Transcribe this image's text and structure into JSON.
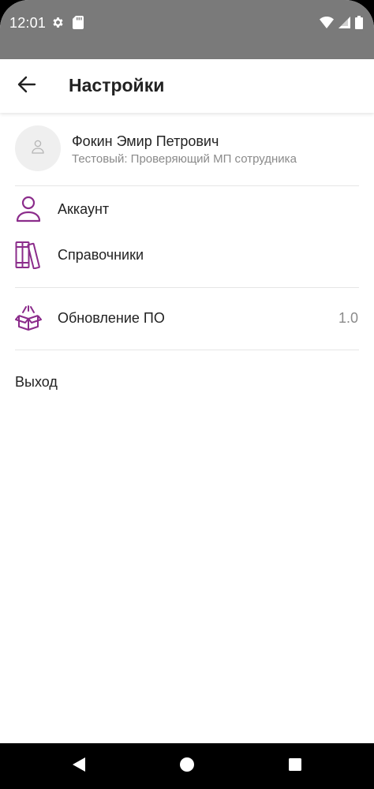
{
  "status_bar": {
    "time": "12:01",
    "icons_left": [
      "gear-icon",
      "sd-card-icon"
    ],
    "icons_right": [
      "wifi-icon",
      "cell-signal-icon",
      "battery-icon"
    ]
  },
  "app_bar": {
    "back_icon": "arrow-left-icon",
    "title": "Настройки"
  },
  "profile": {
    "avatar_icon": "person-icon",
    "name": "Фокин Эмир Петрович",
    "role": "Тестовый: Проверяющий МП сотрудника"
  },
  "menu": {
    "account": {
      "icon": "person-outline-icon",
      "label": "Аккаунт"
    },
    "directories": {
      "icon": "books-icon",
      "label": "Справочники"
    },
    "update": {
      "icon": "open-box-icon",
      "label": "Обновление ПО",
      "value": "1.0"
    },
    "logout": {
      "label": "Выход"
    }
  },
  "nav_bar": {
    "buttons": [
      "back-triangle-icon",
      "home-circle-icon",
      "recents-square-icon"
    ]
  },
  "colors": {
    "accent": "#8b2c8b",
    "status_bar": "#7a7a7a",
    "divider": "#e6e6e6",
    "secondary_text": "#8a8a8a"
  }
}
